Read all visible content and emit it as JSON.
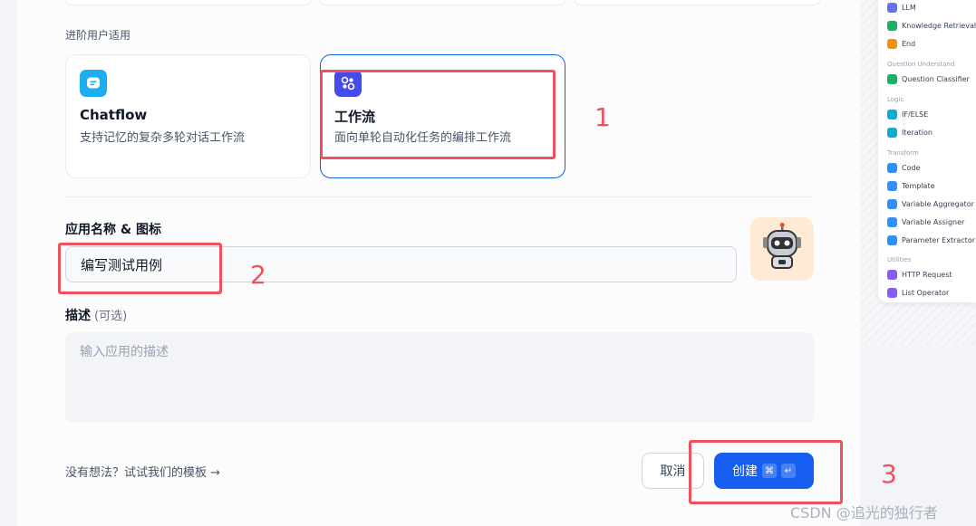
{
  "section_label": "进阶用户适用",
  "app_types": [
    {
      "title": "Chatflow",
      "description": "支持记忆的复杂多轮对话工作流",
      "icon": "chatflow-icon",
      "color": "#1eaef0"
    },
    {
      "title": "工作流",
      "description": "面向单轮自动化任务的编排工作流",
      "icon": "workflow-icon",
      "color": "#444ce7"
    }
  ],
  "name_field": {
    "label": "应用名称 & 图标",
    "value": "编写测试用例",
    "avatar_icon": "robot-icon"
  },
  "description_field": {
    "label": "描述",
    "optional": "(可选)",
    "placeholder": "输入应用的描述"
  },
  "footer": {
    "template_link": "没有想法？试试我们的模板 →",
    "cancel_label": "取消",
    "create_label": "创建",
    "shortcut_cmd": "⌘",
    "shortcut_enter": "↵"
  },
  "annotations": [
    "1",
    "2",
    "3"
  ],
  "preview": {
    "groups": [
      "Question Understand",
      "Logic",
      "Transform",
      "Utilities"
    ],
    "items": [
      {
        "label": "LLM",
        "color": "#6172f3"
      },
      {
        "label": "Knowledge Retrieval",
        "color": "#16b364"
      },
      {
        "label": "End",
        "color": "#f79009"
      },
      {
        "label": "Question Classifier",
        "color": "#16b364"
      },
      {
        "label": "IF/ELSE",
        "color": "#06aed4"
      },
      {
        "label": "Iteration",
        "color": "#06aed4"
      },
      {
        "label": "Code",
        "color": "#2e90fa"
      },
      {
        "label": "Template",
        "color": "#2e90fa"
      },
      {
        "label": "Variable Aggregator",
        "color": "#2e90fa"
      },
      {
        "label": "Variable Assigner",
        "color": "#2e90fa"
      },
      {
        "label": "Parameter Extractor",
        "color": "#2e90fa"
      },
      {
        "label": "HTTP Request",
        "color": "#875bf7"
      },
      {
        "label": "List Operator",
        "color": "#875bf7"
      }
    ]
  },
  "watermark": "CSDN @追光的独行者"
}
